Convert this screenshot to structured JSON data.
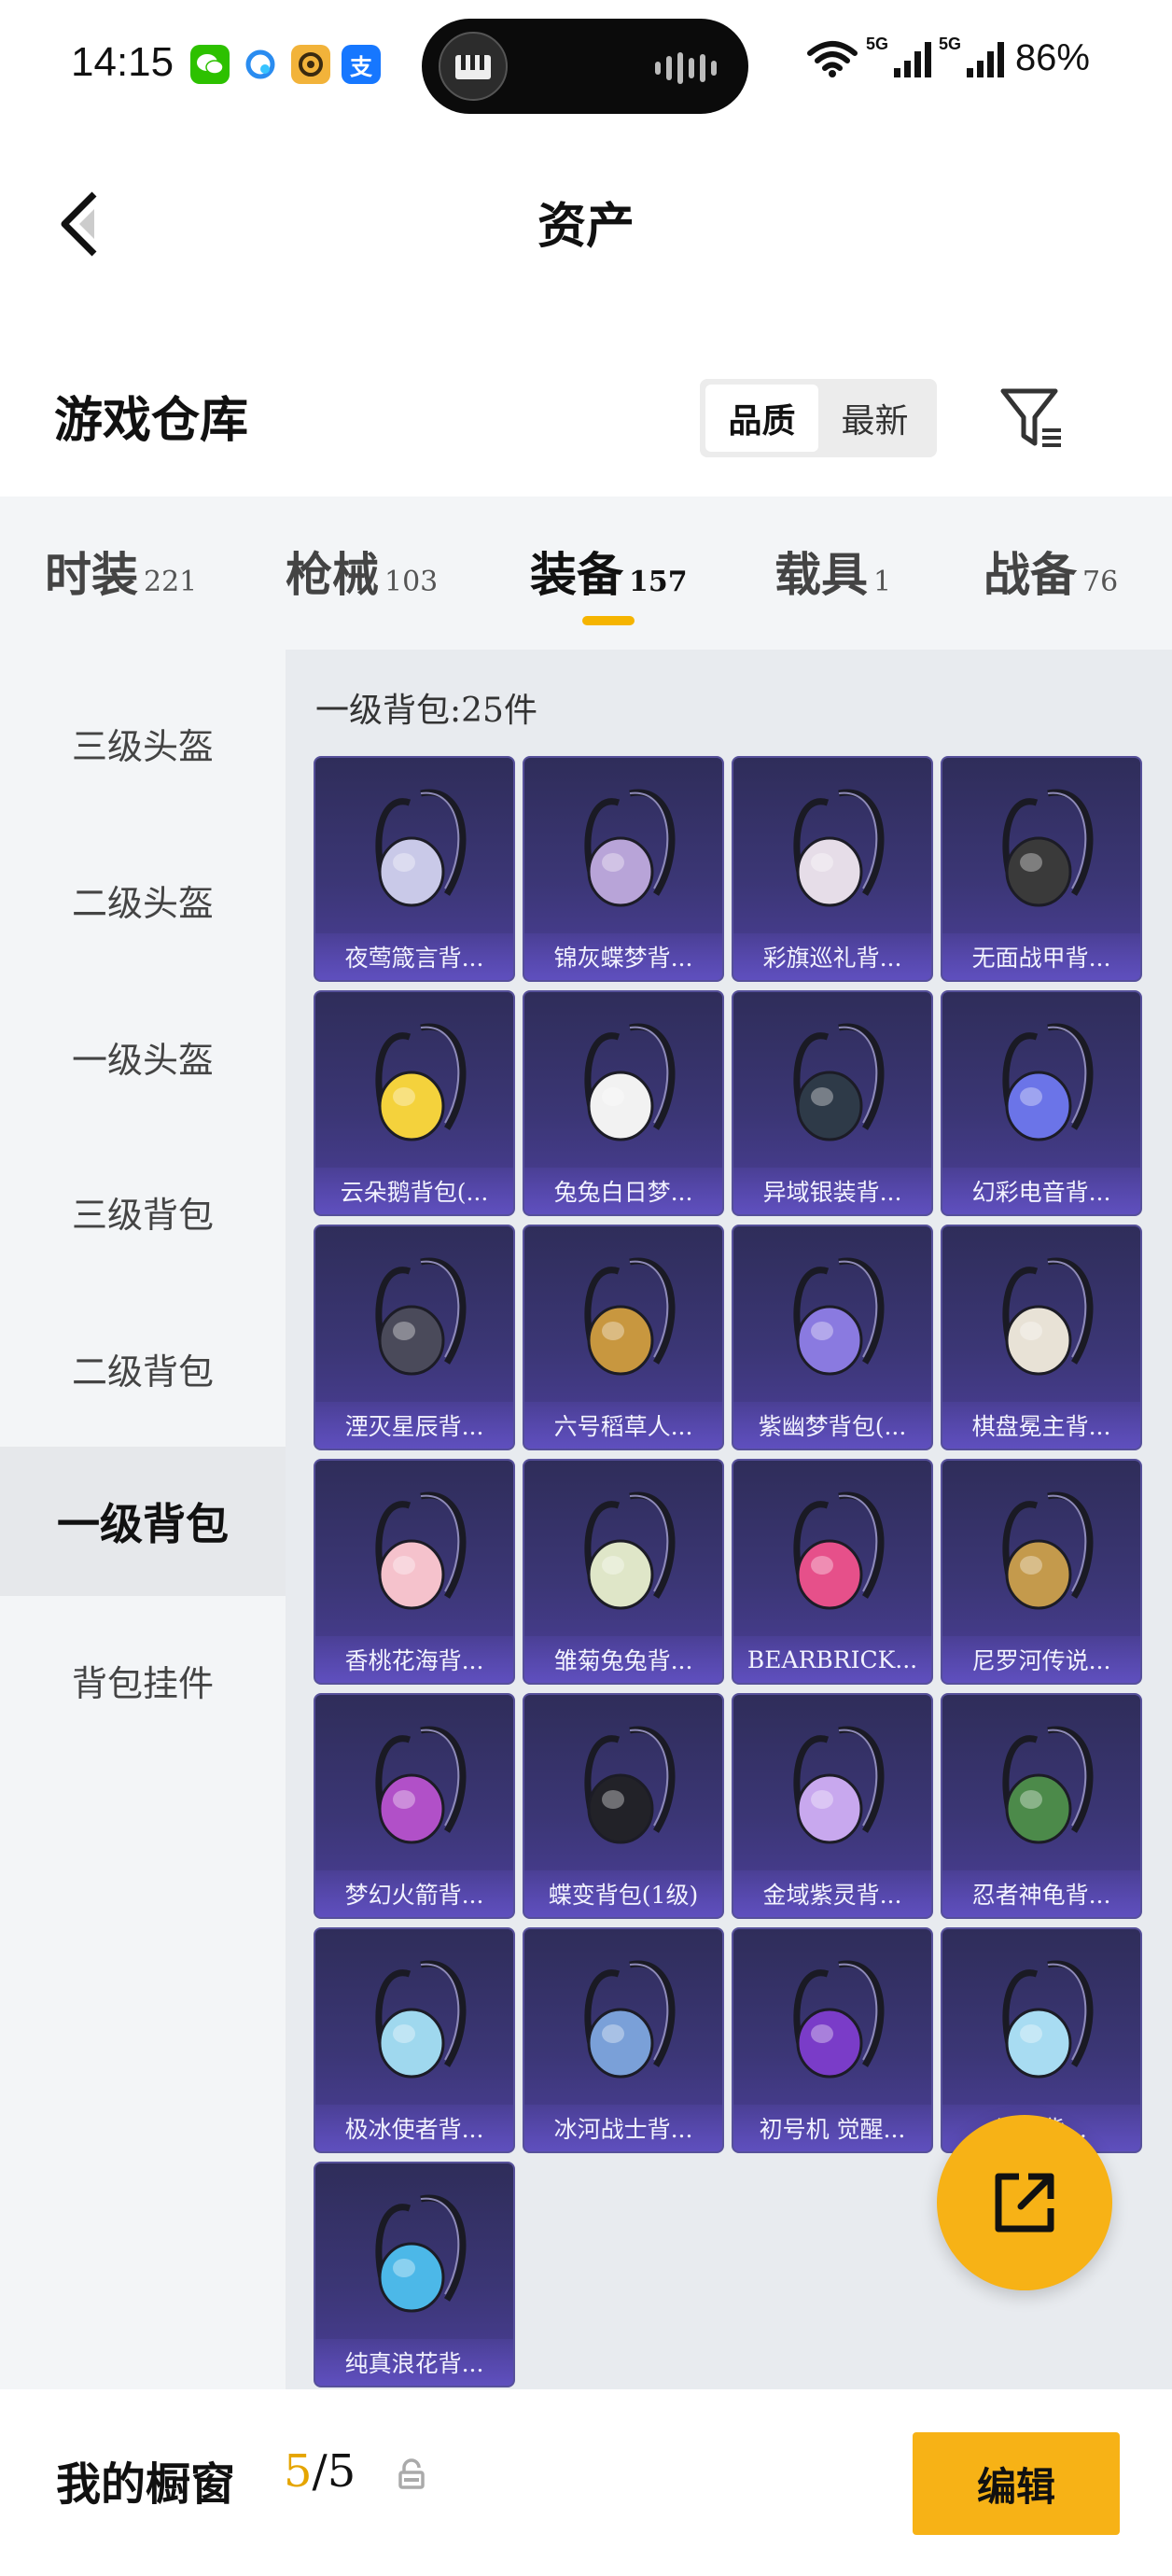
{
  "status_bar": {
    "time": "14:15",
    "battery": "86%",
    "network_1": "5G",
    "network_2": "5G",
    "app_icons": [
      "wechat-icon",
      "qq-browser-icon",
      "game-app-icon",
      "alipay-icon"
    ],
    "alipay_glyph": "支"
  },
  "header": {
    "title": "资产"
  },
  "warehouse": {
    "title": "游戏仓库",
    "sort_options": [
      {
        "label": "品质",
        "active": true
      },
      {
        "label": "最新",
        "active": false
      }
    ]
  },
  "tabs": [
    {
      "label": "时装",
      "count": "221",
      "active": false
    },
    {
      "label": "枪械",
      "count": "103",
      "active": false
    },
    {
      "label": "装备",
      "count": "157",
      "active": true
    },
    {
      "label": "载具",
      "count": "1",
      "active": false
    },
    {
      "label": "战备",
      "count": "76",
      "active": false
    }
  ],
  "side_menu": [
    {
      "label": "三级头盔",
      "active": false
    },
    {
      "label": "二级头盔",
      "active": false
    },
    {
      "label": "一级头盔",
      "active": false
    },
    {
      "label": "三级背包",
      "active": false
    },
    {
      "label": "二级背包",
      "active": false
    },
    {
      "label": "一级背包",
      "active": true
    },
    {
      "label": "背包挂件",
      "active": false
    }
  ],
  "section": {
    "title": "一级背包:25件"
  },
  "items": [
    {
      "name": "夜莺箴言背...",
      "accent": "#c9c9e8"
    },
    {
      "name": "锦灰蝶梦背...",
      "accent": "#b8a4d8"
    },
    {
      "name": "彩旗巡礼背...",
      "accent": "#e6dde8"
    },
    {
      "name": "无面战甲背...",
      "accent": "#3a3a3a"
    },
    {
      "name": "云朵鹅背包(...",
      "accent": "#f4d23c"
    },
    {
      "name": "兔兔白日梦...",
      "accent": "#f2f2f2"
    },
    {
      "name": "异域银装背...",
      "accent": "#2e3a48"
    },
    {
      "name": "幻彩电音背...",
      "accent": "#6b74e8"
    },
    {
      "name": "湮灭星辰背...",
      "accent": "#4a4a5a"
    },
    {
      "name": "六号稻草人...",
      "accent": "#c8973f"
    },
    {
      "name": "紫幽梦背包(...",
      "accent": "#8a7ae0"
    },
    {
      "name": "棋盘冕主背...",
      "accent": "#e8e2d6"
    },
    {
      "name": "香桃花海背...",
      "accent": "#f5c2cc"
    },
    {
      "name": "雏菊兔兔背...",
      "accent": "#dfe6c8"
    },
    {
      "name": "BEARBRICK...",
      "accent": "#e6508a"
    },
    {
      "name": "尼罗河传说...",
      "accent": "#c49a4c"
    },
    {
      "name": "梦幻火箭背...",
      "accent": "#b150c8"
    },
    {
      "name": "蝶变背包(1级)",
      "accent": "#222228"
    },
    {
      "name": "金域紫灵背...",
      "accent": "#c8a8ee"
    },
    {
      "name": "忍者神龟背...",
      "accent": "#4c8a4a"
    },
    {
      "name": "极冰使者背...",
      "accent": "#9fd8ee"
    },
    {
      "name": "冰河战士背...",
      "accent": "#7aa0d8"
    },
    {
      "name": "初号机 觉醒...",
      "accent": "#7a3cc8"
    },
    {
      "name": "海...背...",
      "accent": "#a8dcf2"
    },
    {
      "name": "纯真浪花背...",
      "accent": "#4cb8e8"
    }
  ],
  "bottom_bar": {
    "label": "我的橱窗",
    "current": "5",
    "total": "/5",
    "edit_label": "编辑"
  },
  "colors": {
    "accent": "#f7b216",
    "card_bg": "#3b3675"
  }
}
